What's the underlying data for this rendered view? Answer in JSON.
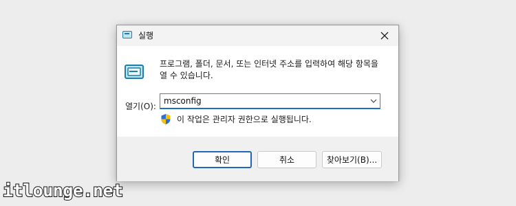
{
  "window": {
    "title": "실행",
    "close_glyph": "✕"
  },
  "dialog": {
    "description": "프로그램, 폴더, 문서, 또는 인터넷 주소를 입력하여 해당 항목을 열 수 있습니다.",
    "open_label": "열기(O):",
    "open_value": "msconfig",
    "admin_note": "이 작업은 관리자 권한으로 실행됩니다."
  },
  "buttons": {
    "ok": "확인",
    "cancel": "취소",
    "browse": "찾아보기(B)..."
  },
  "watermark": "itlounge.net",
  "colors": {
    "accent": "#1f66b6",
    "titlebar": "#f3f3f3",
    "footer": "#f0f0f0",
    "background": "#ededed"
  }
}
